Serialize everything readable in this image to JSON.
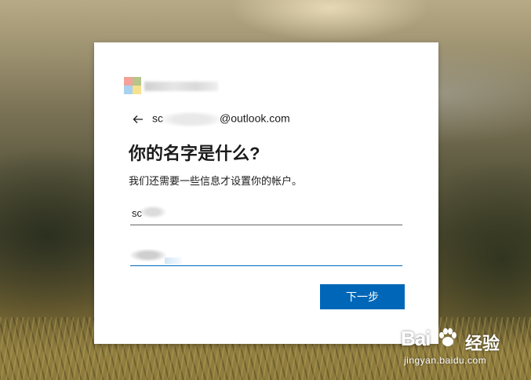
{
  "email": {
    "prefix": "sc",
    "suffix": "@outlook.com"
  },
  "title": "你的名字是什么?",
  "description": "我们还需要一些信息才设置你的帐户。",
  "first_name_field": {
    "value": "sc"
  },
  "last_name_field": {
    "value": ""
  },
  "next_button": {
    "label": "下一步"
  },
  "watermark": {
    "brand": "Bai",
    "brand_suffix": "经验",
    "url": "jingyan.baidu.com"
  },
  "colors": {
    "accent": "#0067b8",
    "card": "#ffffff",
    "text": "#1b1b1b"
  },
  "icons": {
    "back": "left-arrow",
    "logo": "microsoft-logo"
  }
}
